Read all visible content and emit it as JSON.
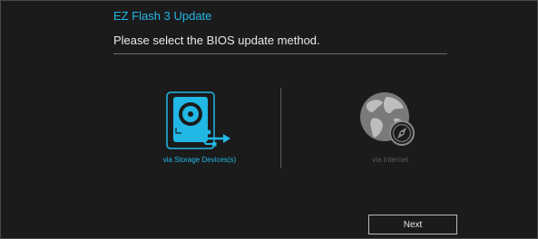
{
  "dialog": {
    "title": "EZ Flash 3 Update",
    "subtitle": "Please select the BIOS update method."
  },
  "options": [
    {
      "label": "via Storage Devices(s)",
      "icon": "storage-usb-icon",
      "state": "active",
      "color": "#22b8e6"
    },
    {
      "label": "via Internet",
      "icon": "globe-compass-icon",
      "state": "disabled",
      "color": "#8a8a8a"
    }
  ],
  "buttons": {
    "next_label": "Next"
  },
  "colors": {
    "accent": "#22b8e6",
    "background": "#1b1b1b",
    "text": "#e9e9e9",
    "disabled": "#5a5a5a"
  }
}
